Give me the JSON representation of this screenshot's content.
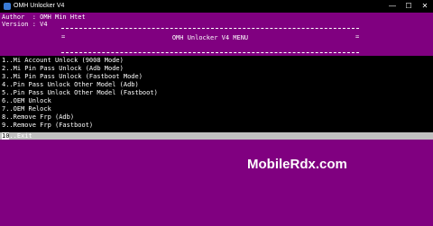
{
  "titlebar": {
    "title": "OMH Unlocker V4",
    "app_icon": "console-app-icon",
    "minimize": "—",
    "maximize": "☐",
    "close": "✕"
  },
  "console": {
    "author_line": "Author  : OMH Min Htet",
    "version_line": "Version : V4",
    "menu_border": "==============================================================",
    "menu_side": "=",
    "menu_title": "OMH Unlocker V4 MENU",
    "options": [
      "1..Mi Account Unlock (9008 Mode)",
      "2..Mi Pin Pass Unlock (Adb Mode)",
      "3..Mi Pin Pass Unlock (Fastboot Mode)",
      "4..Pin Pass Unlock Other Model (Adb)",
      "5..Pin Pass Unlock Other Model (Fastboot)",
      "6..OEM Unlock",
      "7..OEM Relock",
      "8..Remove Frp (Adb)",
      "9..Remove Frp (Fastboot)"
    ],
    "selected_cursor": "10",
    "selected_rest": "..Exit"
  },
  "watermark": "MobileRdx.com",
  "colors": {
    "background": "#800080",
    "panel": "#000000",
    "highlight": "#c0c0c0",
    "text": "#ffffff"
  }
}
